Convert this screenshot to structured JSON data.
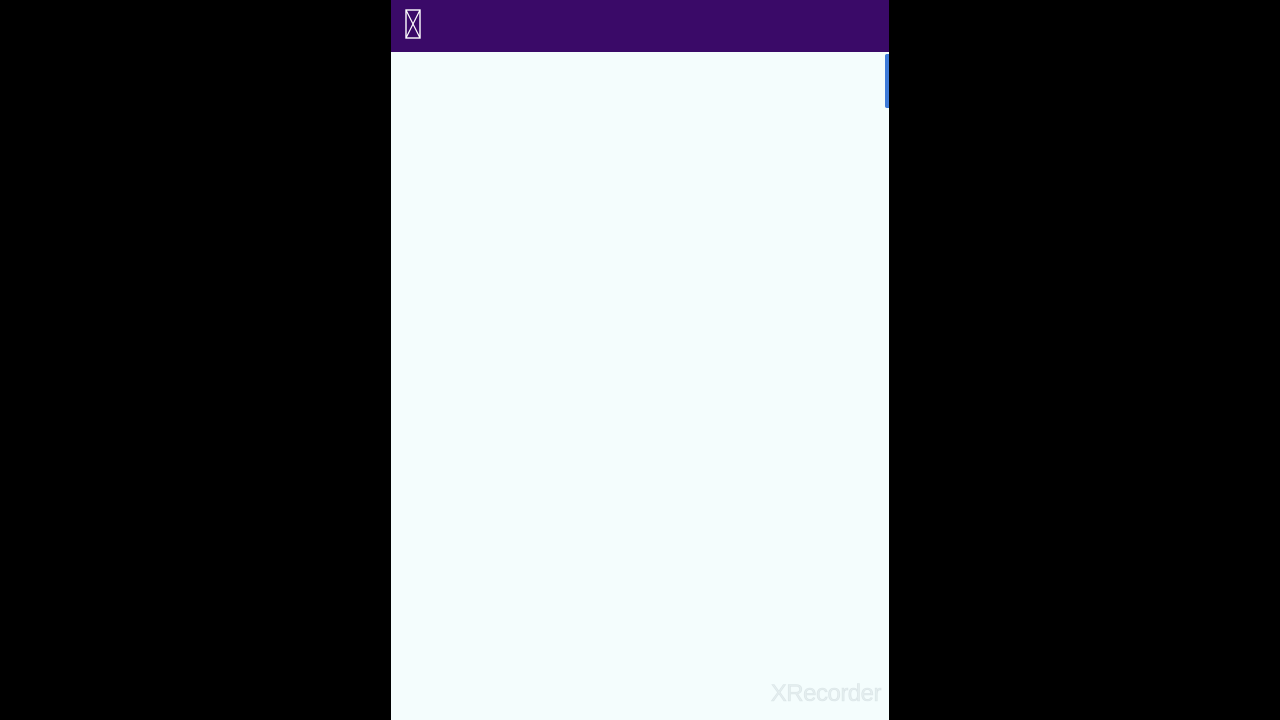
{
  "app_bar": {
    "background_color": "#3a0a68",
    "close_icon": "close-box-icon"
  },
  "content": {
    "background_color": "#f4fdfd",
    "scroll_indicator_color": "#3d7ad8"
  },
  "watermark": {
    "text": "XRecorder"
  }
}
